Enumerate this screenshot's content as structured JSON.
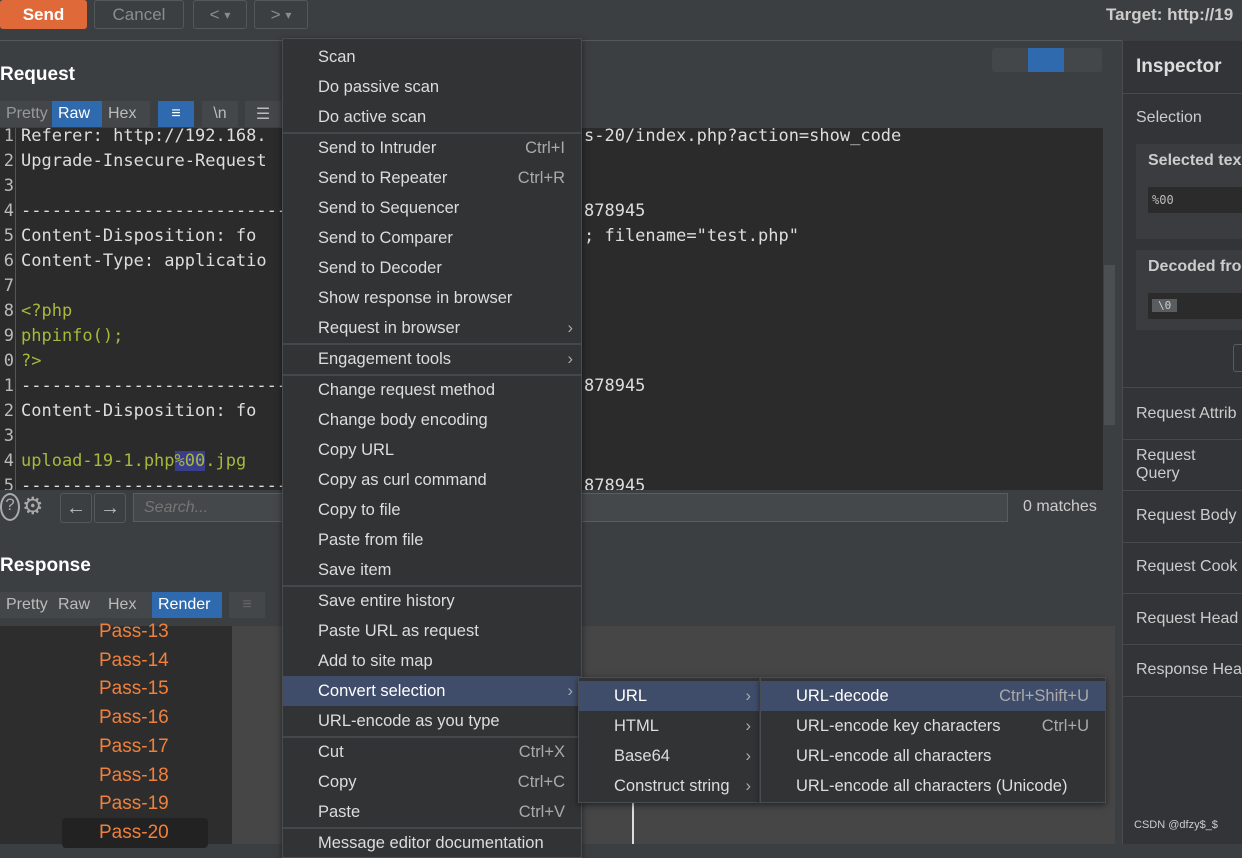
{
  "toolbar": {
    "send": "Send",
    "cancel": "Cancel",
    "prev": "<",
    "next": ">",
    "dropdown": "▾",
    "target": "Target: http://19"
  },
  "request": {
    "title": "Request",
    "tabs": [
      "Pretty",
      "Raw",
      "Hex"
    ],
    "active_tab": "Raw",
    "wrap_icon": "wrap-lines-icon",
    "newline_label": "\\n",
    "menu_icon": "hamburger-icon",
    "line_numbers": [
      "1",
      "2",
      "3",
      "4",
      "5",
      "6",
      "7",
      "8",
      "9",
      "0",
      "1",
      "2",
      "3",
      "4",
      "5"
    ],
    "lines_left": [
      "Referer: http://192.168.",
      "Upgrade-Insecure-Request",
      "",
      "----------------------------",
      "Content-Disposition: fo",
      "Content-Type: applicatio",
      "",
      "<?php",
      "phpinfo();",
      "?>",
      "----------------------------",
      "Content-Disposition: fo",
      "",
      "upload-19-1.php",
      "----------------------------"
    ],
    "selected": "%00",
    "after_selected": ".jpg",
    "lines_right": [
      "s-20/index.php?action=show_code",
      "",
      "",
      "878945",
      "; filename=\"test.php\"",
      "",
      "",
      "",
      "",
      "",
      "878945",
      "",
      "",
      "",
      "878945"
    ],
    "search_placeholder": "Search...",
    "matches": "0 matches"
  },
  "response": {
    "title": "Response",
    "tabs": [
      "Pretty",
      "Raw",
      "Hex",
      "Render"
    ],
    "active_tab": "Render",
    "pass_items": [
      "Pass-13",
      "Pass-14",
      "Pass-15",
      "Pass-16",
      "Pass-17",
      "Pass-18",
      "Pass-19",
      "Pass-20"
    ]
  },
  "context_menu": {
    "items": [
      {
        "label": "Scan"
      },
      {
        "label": "Do passive scan"
      },
      {
        "label": "Do active scan",
        "sep": true
      },
      {
        "label": "Send to Intruder",
        "shortcut": "Ctrl+I"
      },
      {
        "label": "Send to Repeater",
        "shortcut": "Ctrl+R"
      },
      {
        "label": "Send to Sequencer"
      },
      {
        "label": "Send to Comparer"
      },
      {
        "label": "Send to Decoder"
      },
      {
        "label": "Show response in browser"
      },
      {
        "label": "Request in browser",
        "submenu": true,
        "sep": true
      },
      {
        "label": "Engagement tools",
        "submenu": true,
        "sep": true
      },
      {
        "label": "Change request method"
      },
      {
        "label": "Change body encoding"
      },
      {
        "label": "Copy URL"
      },
      {
        "label": "Copy as curl command"
      },
      {
        "label": "Copy to file"
      },
      {
        "label": "Paste from file"
      },
      {
        "label": "Save item",
        "sep": true
      },
      {
        "label": "Save entire history"
      },
      {
        "label": "Paste URL as request"
      },
      {
        "label": "Add to site map"
      },
      {
        "label": "Convert selection",
        "submenu": true,
        "highlighted": true
      },
      {
        "label": "URL-encode as you type",
        "sep": true
      },
      {
        "label": "Cut",
        "shortcut": "Ctrl+X"
      },
      {
        "label": "Copy",
        "shortcut": "Ctrl+C"
      },
      {
        "label": "Paste",
        "shortcut": "Ctrl+V",
        "sep": true
      },
      {
        "label": "Message editor documentation"
      }
    ]
  },
  "submenu1": {
    "items": [
      {
        "label": "URL",
        "submenu": true,
        "highlighted": true
      },
      {
        "label": "HTML",
        "submenu": true
      },
      {
        "label": "Base64",
        "submenu": true
      },
      {
        "label": "Construct string",
        "submenu": true
      }
    ]
  },
  "submenu2": {
    "items": [
      {
        "label": "URL-decode",
        "shortcut": "Ctrl+Shift+U",
        "highlighted": true
      },
      {
        "label": "URL-encode key characters",
        "shortcut": "Ctrl+U"
      },
      {
        "label": "URL-encode all characters"
      },
      {
        "label": "URL-encode all characters (Unicode)"
      }
    ]
  },
  "inspector": {
    "title": "Inspector",
    "selection": "Selection",
    "selected_text_label": "Selected tex",
    "selected_text_value": "%00",
    "decoded_label": "Decoded fro",
    "decoded_value": "\\0",
    "sections": [
      "Request Attrib",
      "Request Query",
      "Request Body",
      "Request Cook",
      "Request Head",
      "Response Hea"
    ]
  },
  "watermark": "CSDN @dfzy$_$",
  "colors": {
    "accent": "#e0693a",
    "active_tab": "#2e6aad",
    "menu_highlight": "#3f4d6b",
    "pass_link": "#f0803c"
  }
}
